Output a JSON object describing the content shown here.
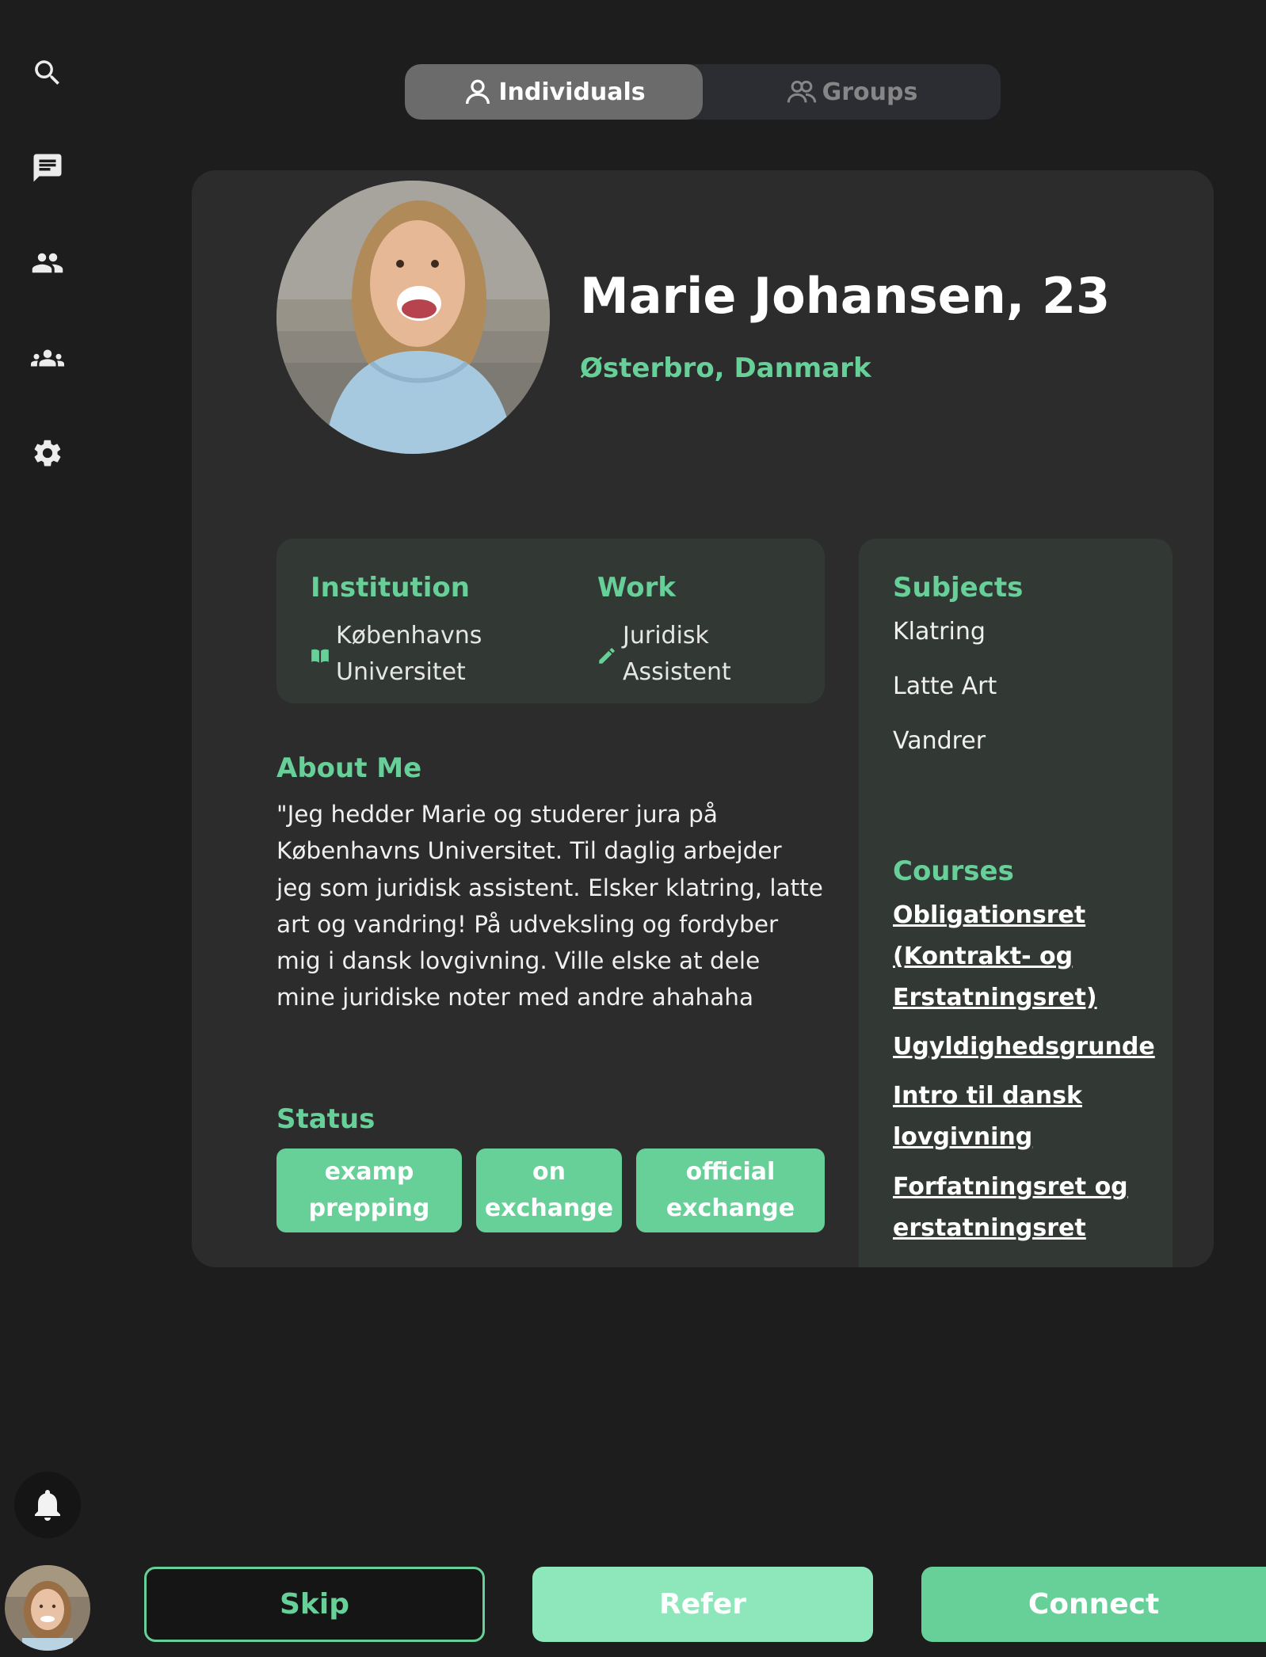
{
  "tabs": {
    "individuals": "Individuals",
    "groups": "Groups"
  },
  "sidebar": {
    "items": [
      {
        "icon": "search-icon"
      },
      {
        "icon": "chat-icon"
      },
      {
        "icon": "people-icon"
      },
      {
        "icon": "groups-icon"
      },
      {
        "icon": "settings-icon"
      }
    ],
    "bell": "bell-icon"
  },
  "profile": {
    "name": "Marie Johansen, 23",
    "location": "Østerbro, Danmark",
    "institution_label": "Institution",
    "institution_line1": "Københavns",
    "institution_line2": "Universitet",
    "work_label": "Work",
    "work_line1": "Juridisk",
    "work_line2": "Assistent",
    "about_label": "About Me",
    "about_text": "\"Jeg hedder Marie og studerer jura på Københavns Universitet. Til daglig arbejder jeg som juridisk assistent. Elsker klatring, latte art og vandring! På udveksling og fordyber mig i dansk lovgivning. Ville elske at dele mine juridiske noter med andre ahahaha",
    "status_label": "Status",
    "status": [
      {
        "line1": "examp",
        "line2": "prepping"
      },
      {
        "line1": "on",
        "line2": "exchange"
      },
      {
        "line1": "official",
        "line2": "exchange"
      }
    ],
    "subjects_label": "Subjects",
    "subjects": [
      "Klatring",
      "Latte Art",
      "Vandrer"
    ],
    "courses_label": "Courses",
    "courses": [
      [
        "Obligationsret",
        "(Kontrakt- og",
        "Erstatningsret)"
      ],
      [
        "Ugyldighedsgrunde"
      ],
      [
        "Intro til dansk",
        "lovgivning"
      ],
      [
        "Forfatningsret og",
        "erstatningsret"
      ]
    ]
  },
  "actions": {
    "skip": "Skip",
    "refer": "Refer",
    "connect": "Connect"
  },
  "colors": {
    "accent": "#67cf98",
    "accent_light": "#8ee6bb",
    "background": "#1d1d1e",
    "card": "#2c2c2c"
  }
}
